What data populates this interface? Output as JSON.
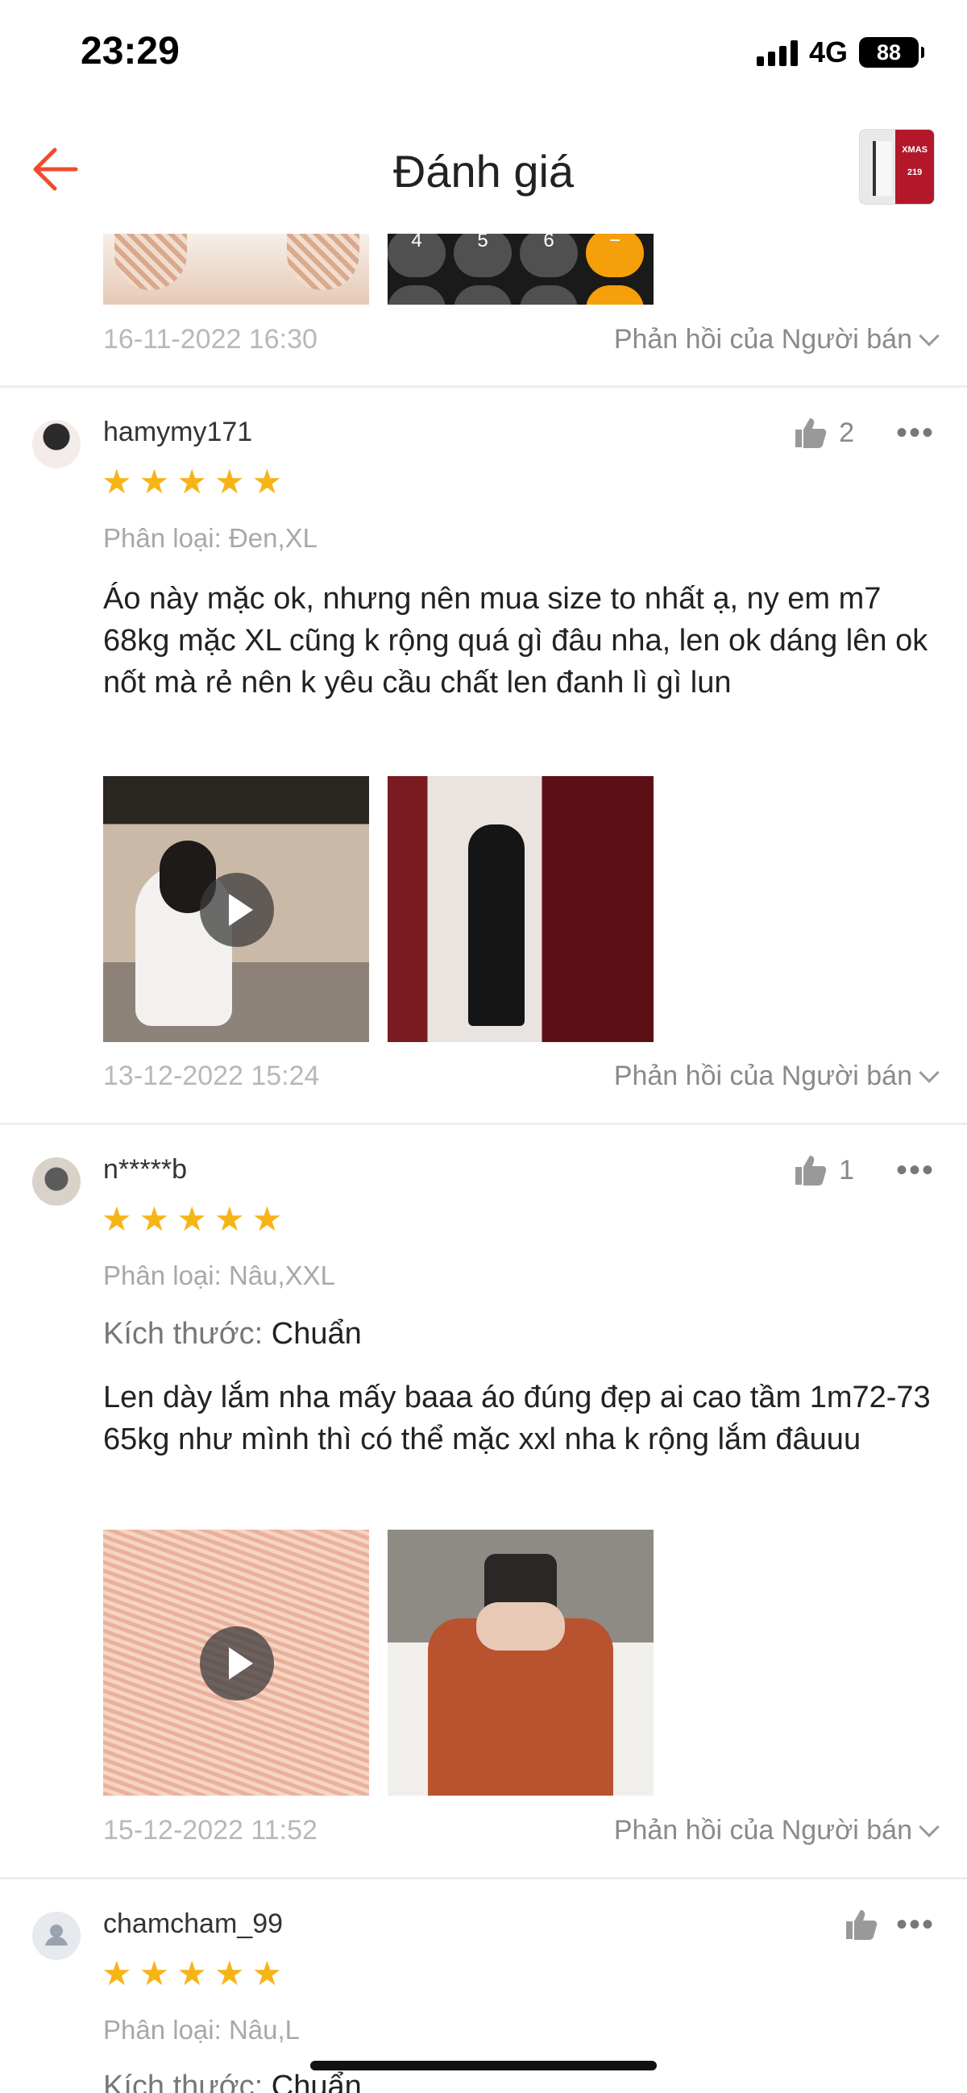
{
  "status": {
    "time": "23:29",
    "network": "4G",
    "battery": "88"
  },
  "nav": {
    "title": "Đánh giá",
    "thumb_text": "XMAS\n219"
  },
  "top": {
    "date": "16-11-2022 16:30",
    "seller_reply": "Phản hồi của Người bán",
    "calc_keys": [
      "4",
      "5",
      "6",
      "−"
    ]
  },
  "reviews": [
    {
      "username": "hamymy171",
      "rating": 5,
      "likes": "2",
      "variant": "Phân loại: Đen,XL",
      "comment": "Áo này mặc ok, nhưng nên mua size to nhất ạ, ny em m7 68kg mặc XL cũng k rộng quá gì đâu nha, len ok dáng lên ok nốt mà rẻ nên k yêu cầu chất len đanh lì gì lun",
      "date": "13-12-2022 15:24",
      "seller_reply": "Phản hồi của Người bán"
    },
    {
      "username": "n*****b",
      "rating": 5,
      "likes": "1",
      "variant": "Phân loại: Nâu,XXL",
      "size_label": "Kích thước:",
      "size_value": "Chuẩn",
      "comment": "Len dày lắm nha mấy baaa áo đúng đẹp ai cao tầm 1m72-73 65kg như mình thì có thể mặc xxl nha k rộng lắm đâuuu",
      "date": "15-12-2022 11:52",
      "seller_reply": "Phản hồi của Người bán"
    },
    {
      "username": "chamcham_99",
      "rating": 5,
      "variant": "Phân loại: Nâu,L",
      "size_label": "Kích thước:",
      "size_value": "Chuẩn"
    }
  ],
  "colors": {
    "accent": "#EE4D2D",
    "star": "#F7B416"
  }
}
